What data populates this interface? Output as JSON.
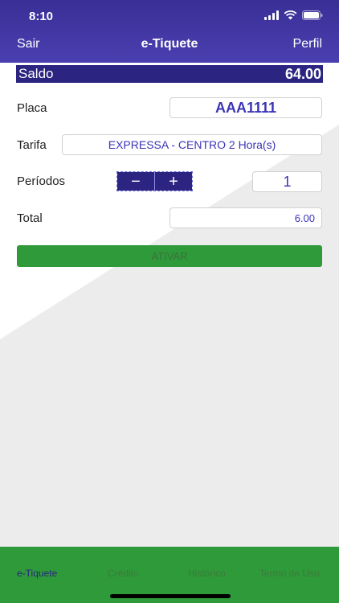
{
  "status": {
    "time": "8:10"
  },
  "nav": {
    "left": "Sair",
    "title": "e-Tiquete",
    "right": "Perfil"
  },
  "saldo": {
    "label": "Saldo",
    "value": "64.00"
  },
  "form": {
    "placa_label": "Placa",
    "placa_value": "AAA1111",
    "tarifa_label": "Tarifa",
    "tarifa_value": "EXPRESSA - CENTRO 2 Hora(s)",
    "periodos_label": "Períodos",
    "decrement": "−",
    "increment": "+",
    "periodos_value": "1",
    "total_label": "Total",
    "total_value": "6.00"
  },
  "activate_label": "ATIVAR",
  "tabs": [
    {
      "label": "e-Tiquete"
    },
    {
      "label": "Crédito"
    },
    {
      "label": "Histórico"
    },
    {
      "label": "Termo de Uso"
    }
  ],
  "colors": {
    "header": "#3a2f96",
    "accent": "#2b2480",
    "tab_bar": "#2e9a3a",
    "field_text": "#3b34b8"
  }
}
